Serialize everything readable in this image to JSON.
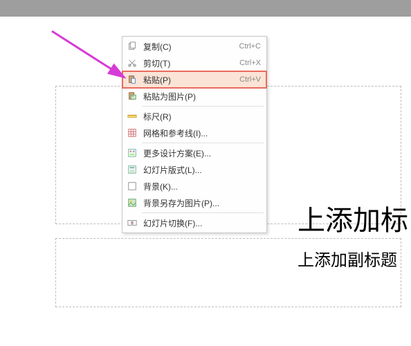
{
  "slide": {
    "title_fragment": "上添加标",
    "subtitle_fragment": "上添加副标题"
  },
  "menu": {
    "copy": {
      "label": "复制(C)",
      "shortcut": "Ctrl+C"
    },
    "cut": {
      "label": "剪切(T)",
      "shortcut": "Ctrl+X"
    },
    "paste": {
      "label": "粘贴(P)",
      "shortcut": "Ctrl+V"
    },
    "paste_as_pic": {
      "label": "粘贴为图片(P)"
    },
    "ruler": {
      "label": "标尺(R)"
    },
    "grid_guides": {
      "label": "网格和参考线(I)..."
    },
    "more_design": {
      "label": "更多设计方案(E)..."
    },
    "slide_layout": {
      "label": "幻灯片版式(L)..."
    },
    "background": {
      "label": "背景(K)..."
    },
    "save_bg_as_pic": {
      "label": "背景另存为图片(P)..."
    },
    "slide_transition": {
      "label": "幻灯片切换(F)..."
    }
  },
  "colors": {
    "highlight": "#fbe3d6",
    "arrow": "#d63cd6",
    "box": "#e86b5c"
  }
}
